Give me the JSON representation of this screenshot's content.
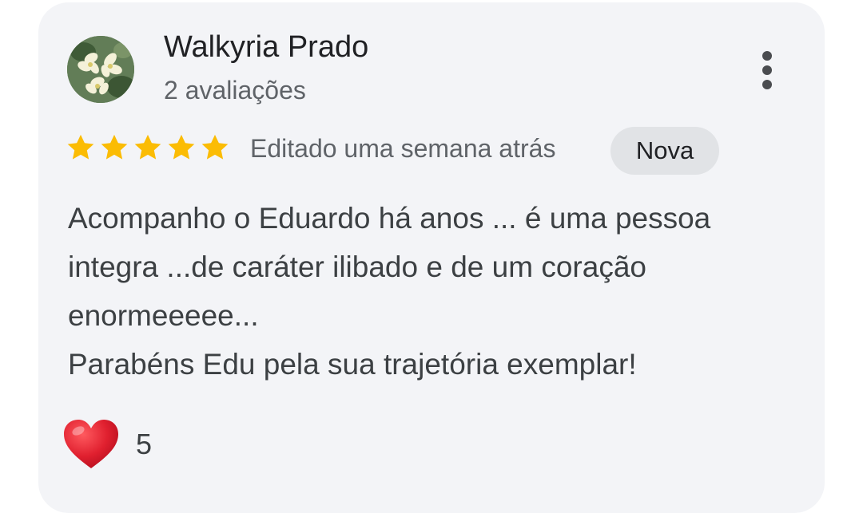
{
  "review": {
    "author": {
      "name": "Walkyria Prado",
      "reviews_count": "2 avaliações",
      "avatar": "flowers-photo"
    },
    "rating": {
      "value": 5,
      "max": 5,
      "color": "#fbbc04"
    },
    "edited_label": "Editado uma semana atrás",
    "badge": "Nova",
    "text_lines": [
      "Acompanho o Eduardo há anos ... é uma pessoa",
      "integra ...de caráter ilibado e de um coração",
      "enormeeeee...",
      "Parabéns Edu pela sua trajetória exemplar!"
    ],
    "reaction": {
      "icon": "heart-icon",
      "count": "5",
      "color": "#e0202f"
    },
    "menu_icon": "more-vert-icon"
  }
}
